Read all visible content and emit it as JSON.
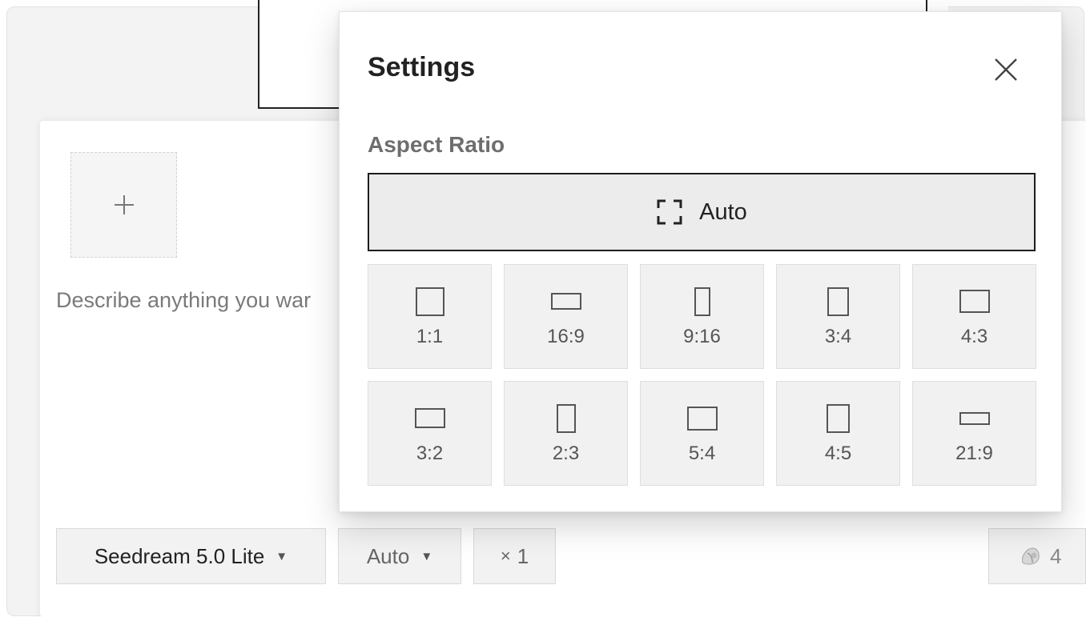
{
  "composer": {
    "upload_icon": "plus-icon",
    "prompt_placeholder": "Describe anything you war",
    "model_label": "Seedream 5.0 Lite",
    "aspect_label": "Auto",
    "count_prefix": "×",
    "count_value": "1",
    "credits_icon": "shell-icon",
    "credits_value": "4"
  },
  "settings": {
    "title": "Settings",
    "close_icon": "close-icon",
    "section_label": "Aspect Ratio",
    "auto_option": {
      "icon": "auto-frame-icon",
      "label": "Auto",
      "selected": true
    },
    "ratios": [
      {
        "label": "1:1"
      },
      {
        "label": "16:9"
      },
      {
        "label": "9:16"
      },
      {
        "label": "3:4"
      },
      {
        "label": "4:3"
      },
      {
        "label": "3:2"
      },
      {
        "label": "2:3"
      },
      {
        "label": "5:4"
      },
      {
        "label": "4:5"
      },
      {
        "label": "21:9"
      }
    ]
  },
  "colors": {
    "selected_border": "#1e1e1e",
    "option_bg": "#f1f1f1"
  }
}
